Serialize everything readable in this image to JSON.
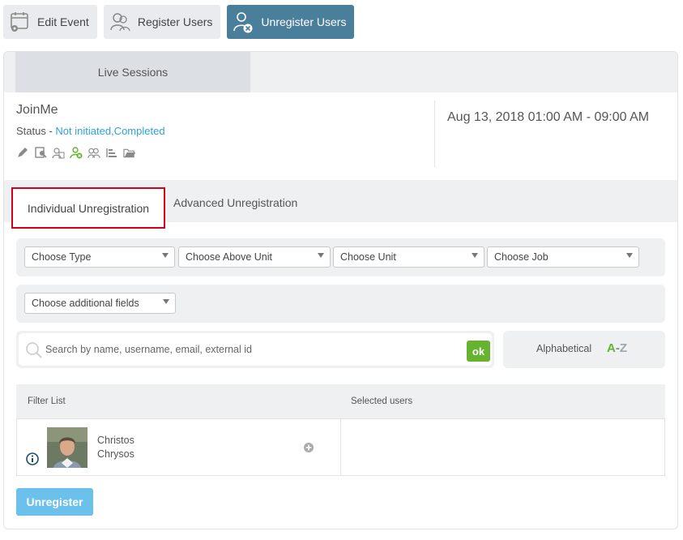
{
  "toolbar": {
    "edit_event": "Edit Event",
    "register_users": "Register Users",
    "unregister_users": "Unregister Users"
  },
  "sessions": {
    "tab_label": "Live Sessions"
  },
  "event": {
    "name": "JoinMe",
    "status_label": "Status - ",
    "status_value": "Not initiated,Completed",
    "date": "Aug 13, 2018 01:00 AM - 09:00 AM",
    "icons": [
      "edit-icon",
      "preview-icon",
      "users-list-icon",
      "unregister-user-icon",
      "group-icon",
      "report-icon",
      "folder-icon"
    ]
  },
  "tabs": {
    "individual": "Individual Unregistration",
    "advanced": "Advanced Unregistration"
  },
  "filters": {
    "type": "Choose Type",
    "above_unit": "Choose Above Unit",
    "unit": "Choose Unit",
    "job": "Choose Job",
    "additional": "Choose additional fields"
  },
  "search": {
    "placeholder": "Search by name, username, email, external id",
    "ok_label": "ok"
  },
  "sort": {
    "label": "Alphabetical",
    "a": "A",
    "dash": "-",
    "z": "Z"
  },
  "list": {
    "filter_header": "Filter List",
    "selected_header": "Selected users",
    "users": [
      {
        "first_name": "Christos",
        "last_name": "Chrysos"
      }
    ]
  },
  "actions": {
    "unregister": "Unregister"
  },
  "colors": {
    "active_tab": "#4a7f9b",
    "status_link": "#2ea3d6",
    "ok_green": "#65b32e",
    "unregister_button": "#6cc0ec",
    "highlight_border": "#d0021b"
  }
}
